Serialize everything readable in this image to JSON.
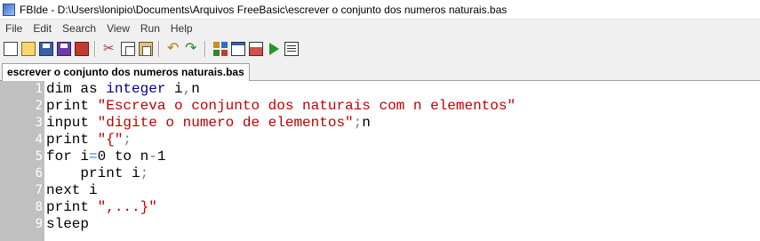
{
  "window": {
    "title": "FBIde - D:\\Users\\lonipio\\Documents\\Arquivos FreeBasic\\escrever o conjunto dos numeros naturais.bas"
  },
  "menu": [
    "File",
    "Edit",
    "Search",
    "View",
    "Run",
    "Help"
  ],
  "toolbar": {
    "icons": [
      "new-file-icon",
      "open-file-icon",
      "save-icon",
      "save-all-icon",
      "close-file-icon",
      "cut-icon",
      "copy-icon",
      "paste-icon",
      "undo-icon",
      "redo-icon",
      "compile-icon",
      "window-icon",
      "results-icon",
      "run-icon",
      "list-icon"
    ]
  },
  "tab": {
    "label": "escrever o conjunto dos numeros naturais.bas"
  },
  "editor": {
    "line_numbers": [
      "1",
      "2",
      "3",
      "4",
      "5",
      "6",
      "7",
      "8",
      "9"
    ],
    "lines": [
      [
        {
          "t": "dim as ",
          "c": "kw"
        },
        {
          "t": "integer",
          "c": "type"
        },
        {
          "t": " i",
          "c": "id"
        },
        {
          "t": ",",
          "c": "op"
        },
        {
          "t": "n",
          "c": "id"
        }
      ],
      [
        {
          "t": "print ",
          "c": "kw"
        },
        {
          "t": "\"Escreva o conjunto dos naturais com n elementos\"",
          "c": "str"
        }
      ],
      [
        {
          "t": "input ",
          "c": "kw"
        },
        {
          "t": "\"digite o numero de elementos\"",
          "c": "str"
        },
        {
          "t": ";",
          "c": "op"
        },
        {
          "t": "n",
          "c": "id"
        }
      ],
      [
        {
          "t": "print ",
          "c": "kw"
        },
        {
          "t": "\"{\"",
          "c": "str"
        },
        {
          "t": ";",
          "c": "op"
        }
      ],
      [
        {
          "t": "for ",
          "c": "kw"
        },
        {
          "t": "i",
          "c": "id"
        },
        {
          "t": "=",
          "c": "op-blue"
        },
        {
          "t": "0 ",
          "c": "num"
        },
        {
          "t": "to ",
          "c": "kw"
        },
        {
          "t": "n",
          "c": "id"
        },
        {
          "t": "-",
          "c": "op-blue"
        },
        {
          "t": "1",
          "c": "num"
        }
      ],
      [
        {
          "t": "    print ",
          "c": "kw"
        },
        {
          "t": "i",
          "c": "id"
        },
        {
          "t": ";",
          "c": "op"
        }
      ],
      [
        {
          "t": "next ",
          "c": "kw"
        },
        {
          "t": "i",
          "c": "id"
        }
      ],
      [
        {
          "t": "print ",
          "c": "kw"
        },
        {
          "t": "\",...}\"",
          "c": "str"
        }
      ],
      [
        {
          "t": "sleep",
          "c": "id"
        }
      ]
    ]
  },
  "colors": {
    "gutter": "#c0c0c0",
    "string": "#c00000",
    "type": "#00008b",
    "operator": "#808080"
  }
}
